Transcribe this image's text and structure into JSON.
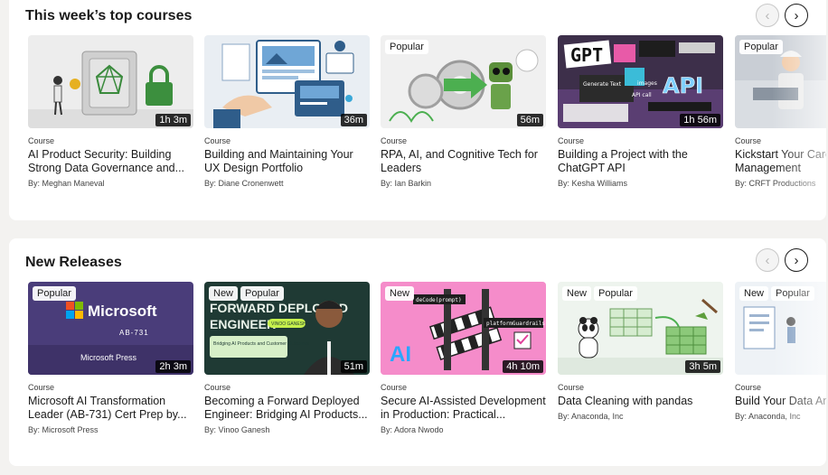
{
  "sections": [
    {
      "title": "This week’s top courses",
      "prev_icon": "chevron-left-icon",
      "next_icon": "chevron-right-icon",
      "prev_glyph": "‹",
      "next_glyph": "›",
      "cards": [
        {
          "type": "Course",
          "title": "AI Product Security: Building Strong Data Governance and...",
          "author": "By: Meghan Maneval",
          "duration": "1h 3m",
          "badges": []
        },
        {
          "type": "Course",
          "title": "Building and Maintaining Your UX Design Portfolio",
          "author": "By: Diane Cronenwett",
          "duration": "36m",
          "badges": []
        },
        {
          "type": "Course",
          "title": "RPA, AI, and Cognitive Tech for Leaders",
          "author": "By: Ian Barkin",
          "duration": "56m",
          "badges": [
            "Popular"
          ]
        },
        {
          "type": "Course",
          "title": "Building a Project with the ChatGPT API",
          "author": "By: Kesha Williams",
          "duration": "1h 56m",
          "badges": []
        },
        {
          "type": "Course",
          "title": "Kickstart Your Career in Project Management",
          "author": "By: CRFT Productions",
          "duration": "",
          "badges": [
            "Popular"
          ]
        }
      ]
    },
    {
      "title": "New Releases",
      "prev_icon": "chevron-left-icon",
      "next_icon": "chevron-right-icon",
      "prev_glyph": "‹",
      "next_glyph": "›",
      "cards": [
        {
          "type": "Course",
          "title": "Microsoft AI Transformation Leader (AB-731) Cert Prep by...",
          "author": "By: Microsoft Press",
          "duration": "2h 3m",
          "badges": [
            "Popular"
          ],
          "thumb_text": {
            "brand": "Microsoft",
            "code": "AB-731",
            "publisher": "Microsoft Press"
          }
        },
        {
          "type": "Course",
          "title": "Becoming a Forward Deployed Engineer: Bridging AI Products...",
          "author": "By: Vinoo Ganesh",
          "duration": "51m",
          "badges": [
            "New",
            "Popular"
          ],
          "thumb_text": {
            "line1": "FORWARD DEPLOYED",
            "line2": "ENGINEER",
            "tag": "VINOO GANESH",
            "sub": "Bridging AI Products and Customer Outcomes"
          }
        },
        {
          "type": "Course",
          "title": "Secure AI-Assisted Development in Production: Practical...",
          "author": "By: Adora Nwodo",
          "duration": "4h 10m",
          "badges": [
            "New"
          ],
          "thumb_text": {
            "big": "AI",
            "code1": "deCode(prompt)",
            "code2": "platformGuardrails"
          }
        },
        {
          "type": "Course",
          "title": "Data Cleaning with pandas",
          "author": "By: Anaconda, Inc",
          "duration": "3h 5m",
          "badges": [
            "New",
            "Popular"
          ]
        },
        {
          "type": "Course",
          "title": "Build Your Data Analysis Skills",
          "author": "By: Anaconda, Inc",
          "duration": "",
          "badges": [
            "New",
            "Popular"
          ]
        }
      ]
    }
  ],
  "thumb_labels": {
    "chatgpt_gpt": "GPT",
    "chatgpt_api": "API",
    "chatgpt_generate": "Generate Text",
    "chatgpt_images": "images",
    "chatgpt_call": "API call"
  }
}
